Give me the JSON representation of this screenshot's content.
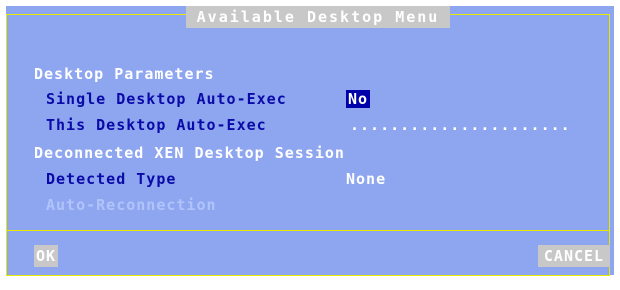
{
  "window": {
    "title": "Available Desktop Menu"
  },
  "sections": {
    "desktop_parameters": "Desktop Parameters",
    "deconnected_session": "Deconnected XEN Desktop Session"
  },
  "fields": {
    "single_autoexec": {
      "label": "Single Desktop Auto-Exec",
      "value": "No"
    },
    "this_autoexec": {
      "label": "This Desktop Auto-Exec",
      "value": "......................"
    },
    "detected_type": {
      "label": "Detected Type",
      "value": "None"
    },
    "auto_reconnection": {
      "label": "Auto-Reconnection"
    }
  },
  "buttons": {
    "ok": "OK",
    "cancel": "CANCEL"
  },
  "colors": {
    "panel_bg": "#8ea6ef",
    "frame": "#e8e800",
    "label_navy": "#0a0aa8",
    "selection": "#0000aa",
    "button_bg": "#c8c8c8"
  }
}
